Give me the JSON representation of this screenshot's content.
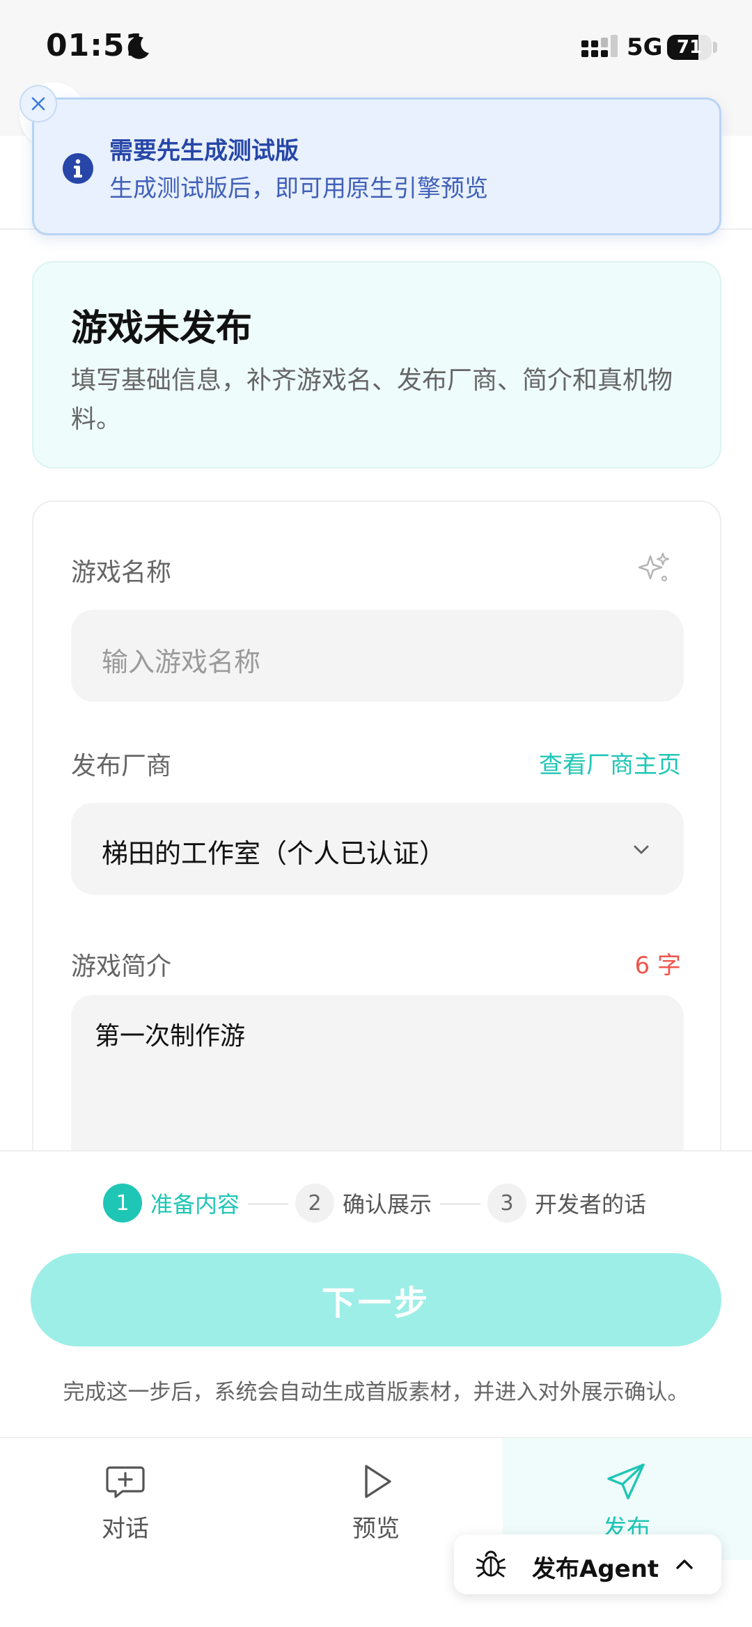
{
  "status_bar": {
    "time": "01:51",
    "network": "5G",
    "battery": "71",
    "battery_level": 0.71
  },
  "toast": {
    "title": "需要先生成测试版",
    "message": "生成测试版后，即可用原生引擎预览",
    "icon": "info-icon",
    "close_icon": "close-icon"
  },
  "hero": {
    "title": "游戏未发布",
    "description": "填写基础信息，补齐游戏名、发布厂商、简介和真机物料。"
  },
  "form": {
    "name_label": "游戏名称",
    "name_placeholder": "输入游戏名称",
    "name_value": "",
    "publisher_label": "发布厂商",
    "publisher_link": "查看厂商主页",
    "publisher_value": "梯田的工作室（个人已认证）",
    "intro_label": "游戏简介",
    "intro_count": "6 字",
    "intro_value": "第一次制作游"
  },
  "steps": [
    {
      "num": "1",
      "label": "准备内容",
      "active": true
    },
    {
      "num": "2",
      "label": "确认展示",
      "active": false
    },
    {
      "num": "3",
      "label": "开发者的话",
      "active": false
    }
  ],
  "actions": {
    "next_label": "下一步",
    "hint": "完成这一步后，系统会自动生成首版素材，并进入对外展示确认。"
  },
  "tabs": [
    {
      "label": "对话",
      "icon": "chat-add-icon",
      "active": false
    },
    {
      "label": "预览",
      "icon": "play-icon",
      "active": false
    },
    {
      "label": "发布",
      "icon": "send-icon",
      "active": true
    }
  ],
  "agent": {
    "label": "发布Agent",
    "icon": "bug-icon"
  },
  "colors": {
    "accent": "#1fc6b6",
    "accent_light": "#9deee7",
    "toast_bg": "#e8f1fd",
    "toast_text": "#2746a8",
    "count_red": "#f0544c"
  }
}
